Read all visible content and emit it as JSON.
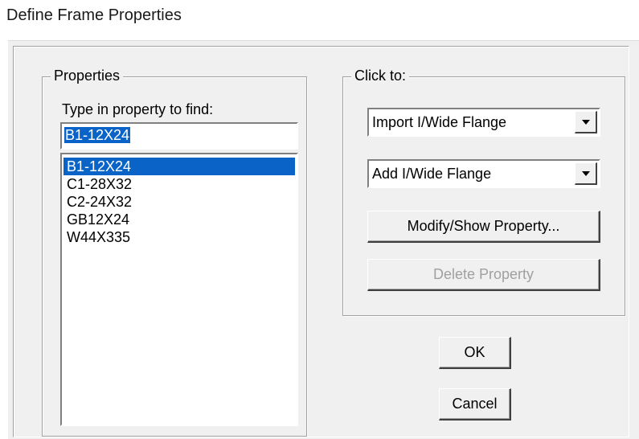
{
  "window": {
    "title": "Define Frame Properties"
  },
  "properties_group": {
    "legend": "Properties",
    "find_label": "Type in property to find:",
    "find_value": "B1-12X24",
    "items": [
      {
        "label": "B1-12X24",
        "selected": true
      },
      {
        "label": "C1-28X32",
        "selected": false
      },
      {
        "label": "C2-24X32",
        "selected": false
      },
      {
        "label": "GB12X24",
        "selected": false
      },
      {
        "label": "W44X335",
        "selected": false
      }
    ]
  },
  "click_group": {
    "legend": "Click to:",
    "import_combo": "Import I/Wide Flange",
    "add_combo": "Add I/Wide Flange",
    "modify_button": "Modify/Show Property...",
    "delete_button": "Delete Property"
  },
  "buttons": {
    "ok": "OK",
    "cancel": "Cancel"
  },
  "colors": {
    "selection": "#0a64c8",
    "dialog_bg": "#f0f0f0",
    "disabled_text": "#a0a0a0"
  }
}
